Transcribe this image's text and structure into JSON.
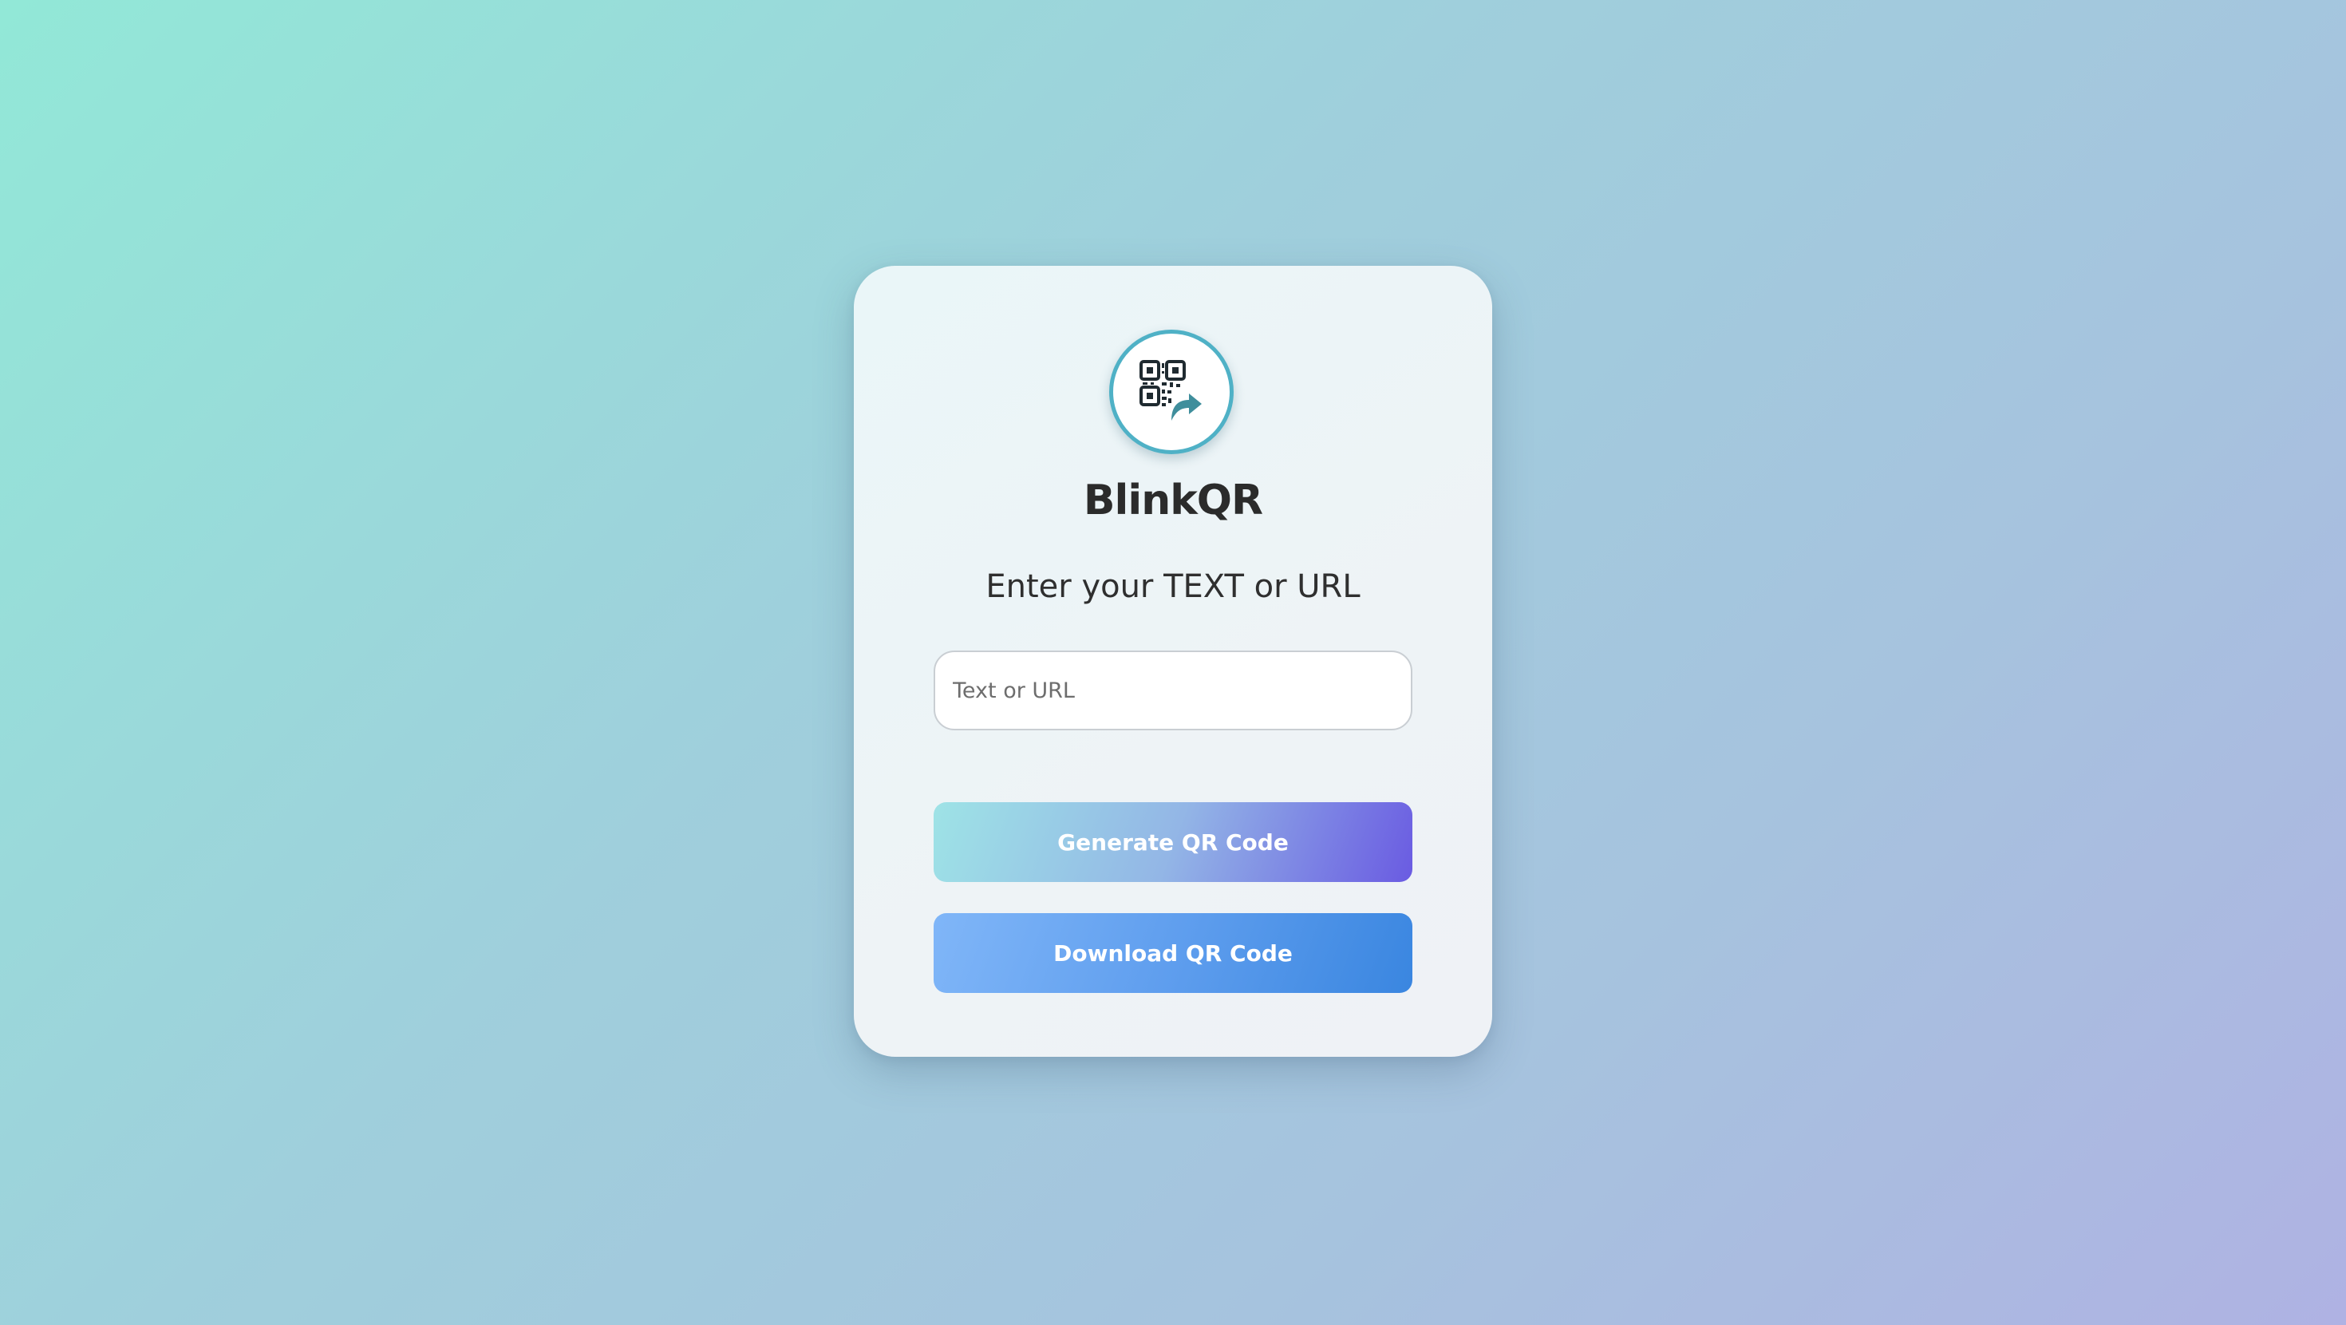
{
  "app": {
    "name": "BlinkQR",
    "logo_icon": "qr-code-share-icon"
  },
  "form": {
    "heading": "Enter your TEXT or URL",
    "input_placeholder": "Text or URL",
    "input_value": ""
  },
  "buttons": {
    "generate_label": "Generate QR Code",
    "download_label": "Download QR Code"
  },
  "colors": {
    "background_start": "#92e8d7",
    "background_end": "#afb2e3",
    "logo_ring": "#4fb1c6",
    "generate_gradient_start": "#9ee3e6",
    "generate_gradient_end": "#6a5be2",
    "download_gradient_start": "#80b6f8",
    "download_gradient_end": "#3a86e0"
  }
}
